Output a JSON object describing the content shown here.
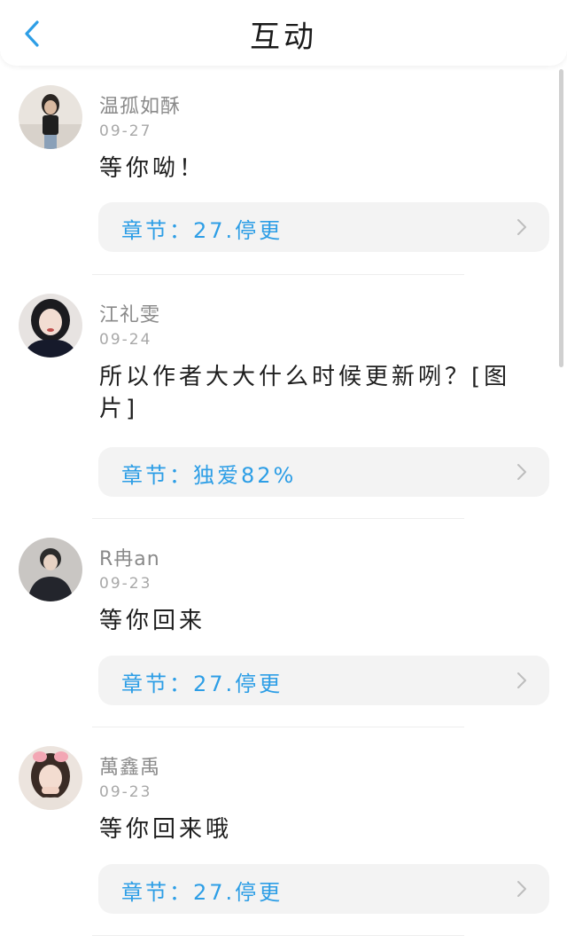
{
  "header": {
    "title": "互动",
    "back_icon": "chevron-left-icon"
  },
  "colors": {
    "accent": "#2d9ee6",
    "pill_bg": "#f3f3f3"
  },
  "comments": [
    {
      "username": "温孤如酥",
      "date": "09-27",
      "text": "等你呦！",
      "chapter": "章节：27.停更"
    },
    {
      "username": "江礼雯",
      "date": "09-24",
      "text": "所以作者大大什么时候更新咧？[图片]",
      "chapter": "章节：独爱82%"
    },
    {
      "username": "R冉an",
      "date": "09-23",
      "text": "等你回来",
      "chapter": "章节：27.停更"
    },
    {
      "username": "萬鑫禹",
      "date": "09-23",
      "text": "等你回来哦",
      "chapter": "章节：27.停更"
    }
  ]
}
